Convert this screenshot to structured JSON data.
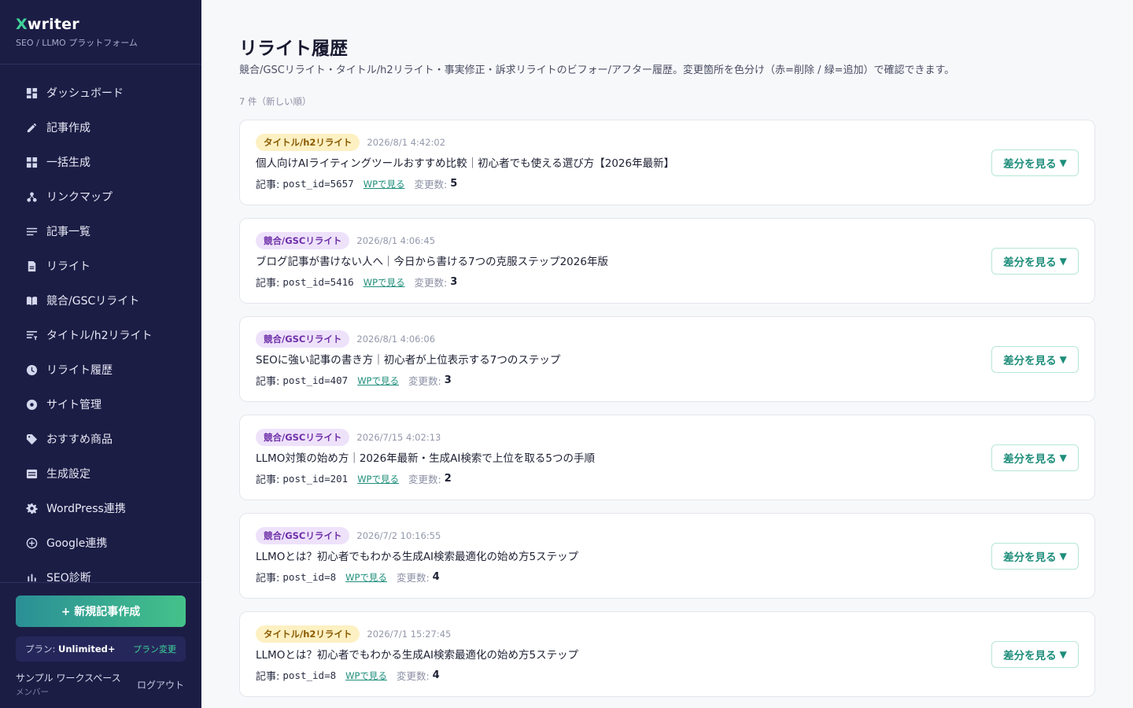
{
  "sidebar": {
    "brand_x": "X",
    "brand_rest": "writer",
    "brand_sub": "SEO / LLMO プラットフォーム",
    "items": [
      {
        "label": "ダッシュボード",
        "icon": "dashboard-icon"
      },
      {
        "label": "記事作成",
        "icon": "pencil-icon"
      },
      {
        "label": "一括生成",
        "icon": "grid-icon"
      },
      {
        "label": "リンクマップ",
        "icon": "network-icon"
      },
      {
        "label": "記事一覧",
        "icon": "list-icon"
      },
      {
        "label": "リライト",
        "icon": "document-icon"
      },
      {
        "label": "競合/GSCリライト",
        "icon": "book-icon"
      },
      {
        "label": "タイトル/h2リライト",
        "icon": "title-icon"
      },
      {
        "label": "リライト履歴",
        "icon": "clock-icon"
      },
      {
        "label": "サイト管理",
        "icon": "site-icon"
      },
      {
        "label": "おすすめ商品",
        "icon": "tag-icon"
      },
      {
        "label": "生成設定",
        "icon": "settings-card-icon"
      },
      {
        "label": "WordPress連携",
        "icon": "gear-icon"
      },
      {
        "label": "Google連携",
        "icon": "plus-circle-icon"
      },
      {
        "label": "SEO診断",
        "icon": "chart-icon"
      }
    ],
    "new_post": "+ 新規記事作成",
    "plan_label": "プラン: ",
    "plan_value": "Unlimited+",
    "plan_change": "プラン変更",
    "workspace_name": "サンプル ワークスペース",
    "workspace_role": "メンバー",
    "logout": "ログアウト"
  },
  "main": {
    "title": "リライト履歴",
    "description": "競合/GSCリライト・タイトル/h2リライト・事実修正・訴求リライトのビフォー/アフター履歴。変更箇所を色分け（赤=削除 / 緑=追加）で確認できます。",
    "count": "7 件（新しい順）",
    "post_label": "記事:",
    "wp_link": "WPで見る",
    "changes_label": "変更数:",
    "diff_button": "差分を見る",
    "diff_arrow": "▼",
    "entries": [
      {
        "badge": "タイトル/h2リライト",
        "type": "title",
        "date": "2026/8/1 4:42:02",
        "title": "個人向けAIライティングツールおすすめ比較｜初心者でも使える選び方【2026年最新】",
        "post": "post_id=5657",
        "changes": "5"
      },
      {
        "badge": "競合/GSCリライト",
        "type": "gsc",
        "date": "2026/8/1 4:06:45",
        "title": "ブログ記事が書けない人へ｜今日から書ける7つの克服ステップ2026年版",
        "post": "post_id=5416",
        "changes": "3"
      },
      {
        "badge": "競合/GSCリライト",
        "type": "gsc",
        "date": "2026/8/1 4:06:06",
        "title": "SEOに強い記事の書き方｜初心者が上位表示する7つのステップ",
        "post": "post_id=407",
        "changes": "3"
      },
      {
        "badge": "競合/GSCリライト",
        "type": "gsc",
        "date": "2026/7/15 4:02:13",
        "title": "LLMO対策の始め方｜2026年最新・生成AI検索で上位を取る5つの手順",
        "post": "post_id=201",
        "changes": "2"
      },
      {
        "badge": "競合/GSCリライト",
        "type": "gsc",
        "date": "2026/7/2 10:16:55",
        "title": "LLMOとは？初心者でもわかる生成AI検索最適化の始め方5ステップ",
        "post": "post_id=8",
        "changes": "4"
      },
      {
        "badge": "タイトル/h2リライト",
        "type": "title",
        "date": "2026/7/1 15:27:45",
        "title": "LLMOとは？初心者でもわかる生成AI検索最適化の始め方5ステップ",
        "post": "post_id=8",
        "changes": "4"
      }
    ]
  },
  "colors": {
    "sidebar_bg": "#1c1d45",
    "accent_green": "#3fd39a",
    "link_teal": "#1d8d7a",
    "badge_title_bg": "#fdf0c2",
    "badge_gsc_bg": "#eee2fb"
  }
}
